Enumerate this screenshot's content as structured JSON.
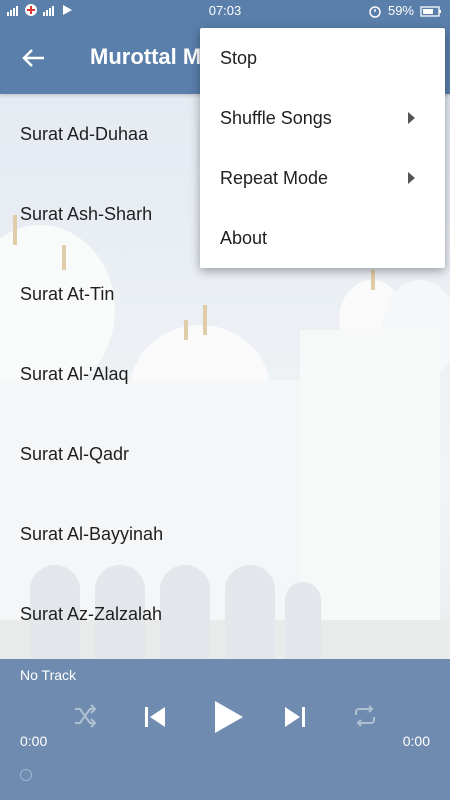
{
  "status_bar": {
    "time": "07:03",
    "battery": "59%"
  },
  "app_bar": {
    "title": "Murottal M"
  },
  "songs": [
    "Surat Ad-Duhaa",
    "Surat Ash-Sharh",
    "Surat At-Tin",
    "Surat Al-'Alaq",
    "Surat Al-Qadr",
    "Surat Al-Bayyinah",
    "Surat Az-Zalzalah"
  ],
  "menu": {
    "stop": "Stop",
    "shuffle": "Shuffle Songs",
    "repeat": "Repeat Mode",
    "about": "About"
  },
  "player": {
    "now_playing": "No Track",
    "elapsed": "0:00",
    "duration": "0:00"
  },
  "colors": {
    "primary": "#5a7fab",
    "player_bg": "#587aa6"
  }
}
